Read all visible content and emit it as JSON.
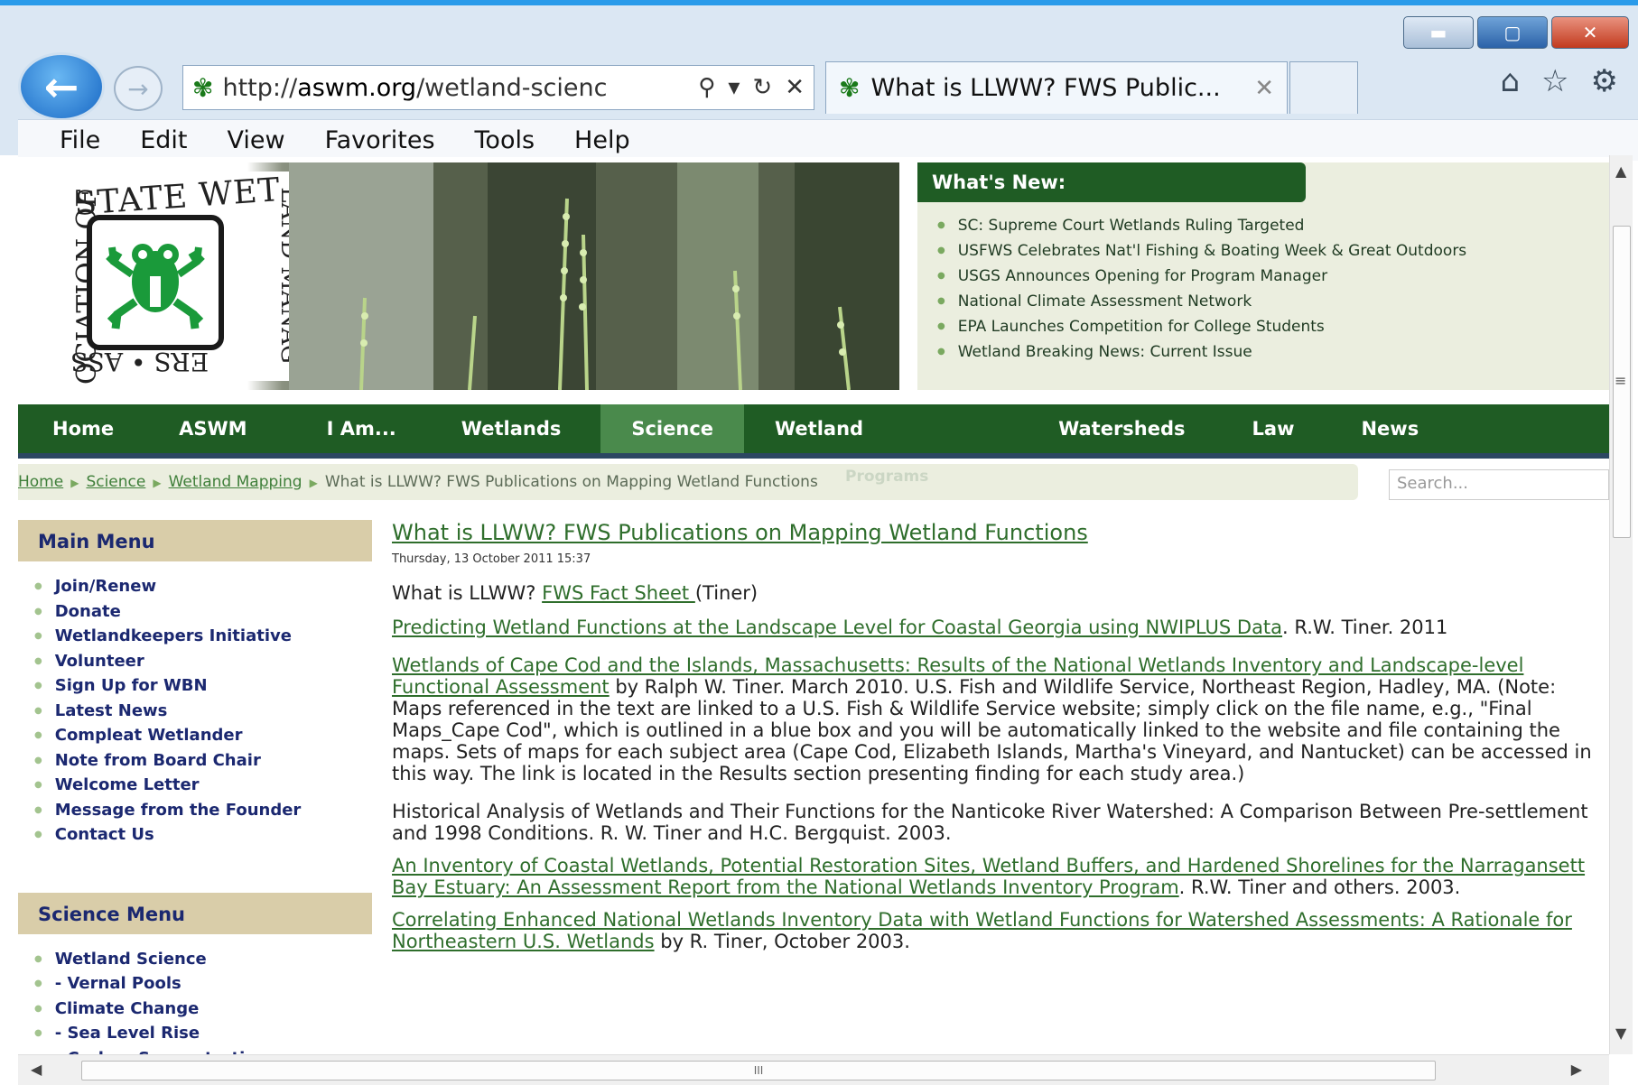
{
  "browser": {
    "url_prefix": "http://",
    "url_domain": "aswm.org",
    "url_rest": "/wetland-scienc",
    "tab_title": "What is LLWW? FWS Public...",
    "menu": [
      "File",
      "Edit",
      "View",
      "Favorites",
      "Tools",
      "Help"
    ],
    "icons": [
      "back-arrow",
      "forward-arrow",
      "search-icon",
      "refresh-icon",
      "stop-icon",
      "home-icon",
      "favorites-star-icon",
      "gear-icon",
      "minimize-icon",
      "maximize-icon",
      "close-icon"
    ]
  },
  "header": {
    "logo_top": "STATE WET",
    "logo_side": "OCIATION OF",
    "logo_right": "LAND MANAG",
    "logo_bottom": "ERS • ASS",
    "whats_new_title": "What's New:",
    "whats_new_items": [
      "SC: Supreme Court Wetlands Ruling Targeted",
      "USFWS Celebrates Nat'l Fishing & Boating Week & Great Outdoors",
      "USGS Announces Opening for Program Manager",
      "National Climate Assessment Network",
      "EPA Launches Competition for College Students",
      "Wetland Breaking News: Current Issue"
    ]
  },
  "nav": {
    "items": [
      "Home",
      "ASWM",
      "I Am...",
      "Wetlands",
      "Science",
      "Wetland",
      "Watersheds",
      "Law",
      "News"
    ],
    "active": "Science",
    "overflow_text": "Programs"
  },
  "breadcrumb": {
    "links": [
      "Home",
      "Science",
      "Wetland Mapping"
    ],
    "current": "What is LLWW? FWS Publications on Mapping Wetland Functions"
  },
  "search": {
    "placeholder": "Search..."
  },
  "sidebar": {
    "main_title": "Main Menu",
    "main_items": [
      "Join/Renew",
      "Donate",
      "Wetlandkeepers Initiative",
      "Volunteer",
      "Sign Up for WBN",
      "Latest News",
      "Compleat Wetlander",
      "Note from Board Chair",
      "Welcome Letter",
      "Message from the Founder",
      "Contact Us"
    ],
    "science_title": "Science Menu",
    "science_items": [
      "Wetland Science",
      "- Vernal Pools",
      "Climate Change",
      "- Sea Level Rise",
      "- Carbon Sequestration"
    ]
  },
  "article": {
    "title": "What is LLWW? FWS Publications on Mapping Wetland Functions",
    "date": "Thursday, 13 October 2011 15:37",
    "p1_text": "What is LLWW? ",
    "p1_link": "FWS Fact Sheet ",
    "p1_tail": "(Tiner)",
    "p2_link": "Predicting Wetland Functions at the Landscape Level for Coastal Georgia using NWIPLUS Data",
    "p2_tail": ". R.W. Tiner. 2011",
    "p3_link": "Wetlands of Cape Cod and the Islands, Massachusetts: Results of the National Wetlands Inventory and Landscape-level Functional Assessment",
    "p3_tail": " by Ralph W. Tiner. March 2010. U.S. Fish and Wildlife Service, Northeast Region, Hadley, MA. (Note: Maps referenced in the text are linked to a U.S. Fish & Wildlife Service website; simply click on the file name, e.g., \"Final Maps_Cape Cod\", which is outlined in a blue box and you will be automatically linked to the website and file containing the maps. Sets of maps for each subject area (Cape Cod, Elizabeth Islands, Martha's Vineyard, and Nantucket) can be accessed in this way. The link is located in the Results section presenting finding for each study area.)",
    "p4_text": "Historical Analysis of Wetlands and Their Functions for the Nanticoke River Watershed: A Comparison Between Pre-settlement and 1998 Conditions. R. W. Tiner and H.C. Bergquist.  2003.",
    "p5_link": "An Inventory of Coastal Wetlands, Potential Restoration Sites, Wetland Buffers, and Hardened Shorelines for the Narragansett Bay Estuary: An Assessment Report from the National Wetlands Inventory Program",
    "p5_tail": ". R.W. Tiner and others. 2003.",
    "p6_link": "Correlating Enhanced National Wetlands Inventory Data with Wetland Functions for Watershed Assessments: A Rationale for Northeastern U.S. Wetlands",
    "p6_tail": " by R. Tiner, October 2003."
  },
  "colors": {
    "nav_green": "#1f5c24",
    "nav_active": "#4a8a4c",
    "link_green": "#2f6e2c",
    "menu_blue": "#1b2870",
    "menu_head": "#d9cda9"
  }
}
